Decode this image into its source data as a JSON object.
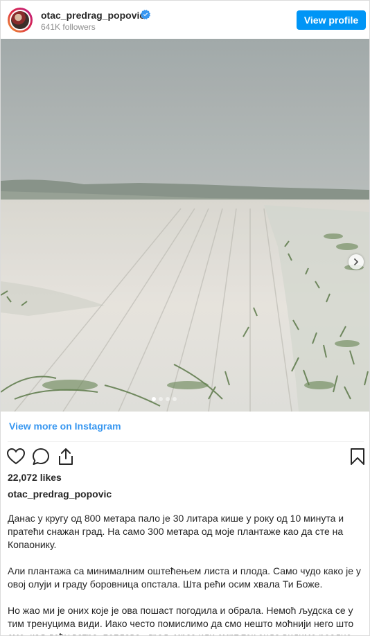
{
  "header": {
    "username": "otac_predrag_popovic",
    "followers": "641K followers",
    "view_profile_label": "View profile"
  },
  "post": {
    "carousel": {
      "slide_count": 4,
      "active_index": 0
    },
    "view_more_label": "View more on Instagram",
    "likes": "22,072 likes",
    "caption_username": "otac_predrag_popovic",
    "caption_paragraphs": [
      "Данас у кругу од 800 метара пало је 30 литара кише у року од 10 минута и пратећи снажан град. На само 300 метара од моје плантаже као да сте на Копаонику.",
      "Али плантажа са минималним оштећењем листа и плода. Само чудо како је у овој олуји и граду боровница опстала. Шта рећи осим хвала Ти Боже.",
      "Но жао ми је оних које је ова пошаст погодила и обрала. Немоћ људска се у тим тренуцима види. Иако често помислимо да смо нешто моћнији него што смо, кад дођу ватра, поплава, ,град, мраз или смрт тек онда видимо реално"
    ]
  },
  "colors": {
    "accent": "#0095f6",
    "link": "#3897f0"
  },
  "icons": [
    "verified-badge-icon",
    "heart-icon",
    "comment-icon",
    "share-icon",
    "bookmark-icon",
    "chevron-right-icon"
  ]
}
